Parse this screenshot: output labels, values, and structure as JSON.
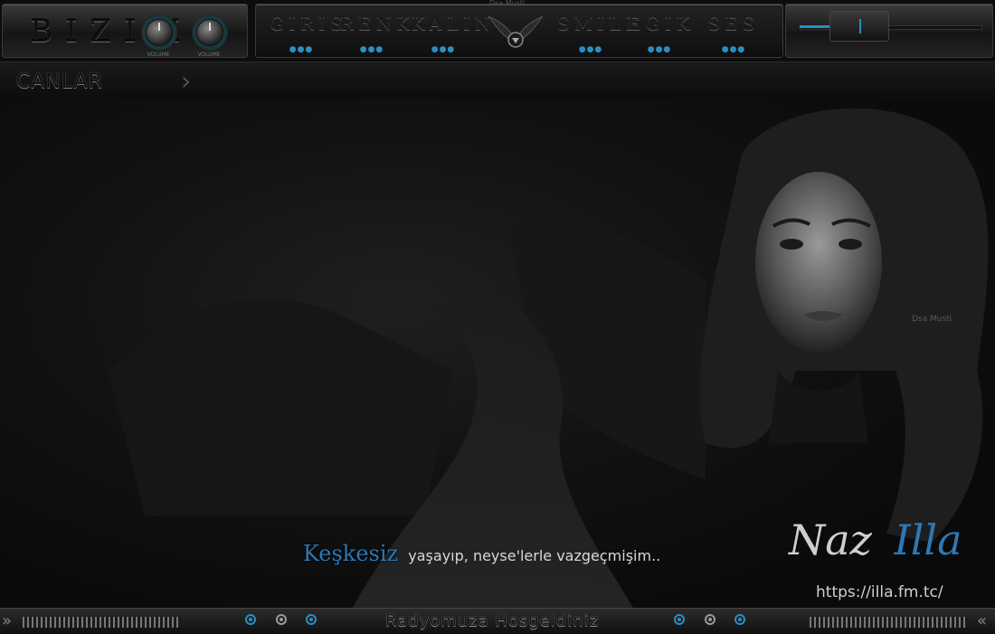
{
  "header": {
    "brand": "BIZIM",
    "small_title": "Dsa Musti",
    "knobs": [
      {
        "label": "VOLUME"
      },
      {
        "label": "VOLUME"
      }
    ],
    "menu": [
      {
        "label": "GIRIS"
      },
      {
        "label": "RENK"
      },
      {
        "label": "KALIN"
      },
      {
        "label": "SMILE"
      },
      {
        "label": "EGIK"
      },
      {
        "label": "SES"
      }
    ],
    "volume_level": 0.28
  },
  "subbar": {
    "title": "CANLAR"
  },
  "main": {
    "quote_lead": "Keşkesiz",
    "quote_rest": "yaşayıp, neyse'lerle vazgeçmişim..",
    "signature_a": "Naz",
    "signature_b": "Illa",
    "url": "https://illa.fm.tc/",
    "watermark": "Dsa Musti"
  },
  "footer": {
    "text": "Radyomuza  Hosgeldiniz"
  },
  "colors": {
    "accent": "#2a8ec0",
    "quote_blue": "#2a79b8",
    "background": "#0a0a0a"
  }
}
